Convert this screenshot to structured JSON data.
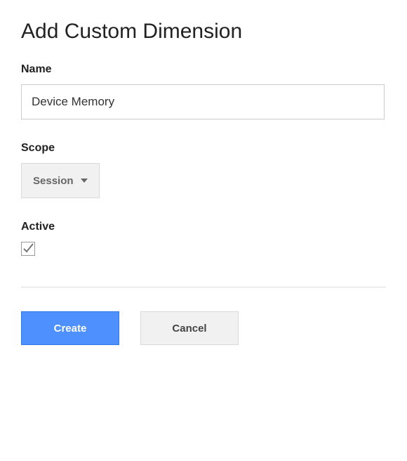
{
  "title": "Add Custom Dimension",
  "fields": {
    "name": {
      "label": "Name",
      "value": "Device Memory"
    },
    "scope": {
      "label": "Scope",
      "selected": "Session"
    },
    "active": {
      "label": "Active",
      "checked": true
    }
  },
  "buttons": {
    "create": "Create",
    "cancel": "Cancel"
  },
  "colors": {
    "primary": "#4d90fe",
    "border": "#ccc"
  }
}
